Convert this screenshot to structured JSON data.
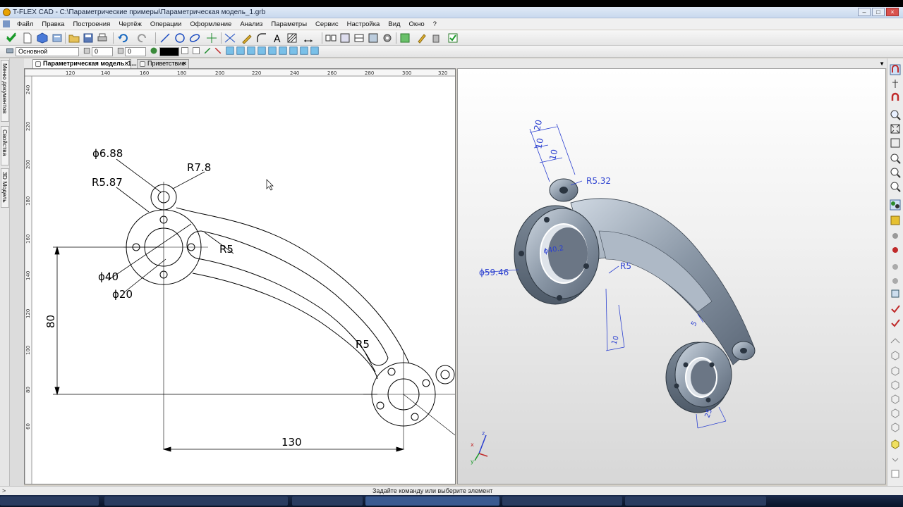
{
  "window": {
    "title": "T-FLEX CAD - C:\\Параметрические примеры\\Параметрическая модель_1.grb"
  },
  "menu": [
    "Файл",
    "Правка",
    "Построения",
    "Чертёж",
    "Операции",
    "Оформление",
    "Анализ",
    "Параметры",
    "Сервис",
    "Настройка",
    "Вид",
    "Окно",
    "?"
  ],
  "toolbar2": {
    "layer_combo": "Основной",
    "level_value": "0",
    "priority_value": "0"
  },
  "tabs": [
    {
      "label": "Параметрическая модель_1...",
      "active": true
    },
    {
      "label": "Приветствие",
      "active": false
    }
  ],
  "left_panel": {
    "tabs": [
      "Меню документов",
      "Свойства",
      "3D Модель"
    ]
  },
  "ruler": {
    "top_ticks": [
      "120",
      "140",
      "160",
      "180",
      "200",
      "220",
      "240",
      "260",
      "280",
      "300",
      "320"
    ],
    "left_ticks": [
      "240",
      "220",
      "200",
      "180",
      "160",
      "140",
      "120",
      "100",
      "80",
      "60"
    ]
  },
  "drawing_2d": {
    "dims": {
      "d_small": "ϕ6.88",
      "r_boss": "R7.8",
      "r_ring": "R5.87",
      "r_inner_slot": "R5",
      "d_outer": "ϕ40",
      "d_inner": "ϕ20",
      "vertical": "80",
      "horizontal": "130",
      "r_lower": "R5"
    }
  },
  "view_3d": {
    "dims": {
      "d1": "20",
      "d2": "10",
      "d3": "10",
      "radius": "R5.32",
      "bore": "ϕ40.2",
      "diameter": "ϕ59.46",
      "r_slot": "R5",
      "rib": "10",
      "slot_w": "5",
      "base": "25"
    },
    "axis_labels": {
      "z": "z",
      "x": "x",
      "y": "y"
    }
  },
  "status": {
    "prompt": ">",
    "message": "Задайте команду или выберите элемент"
  },
  "colors": {
    "dimension_blue": "#2a3fd0",
    "part_steel": "#8a97a6"
  }
}
